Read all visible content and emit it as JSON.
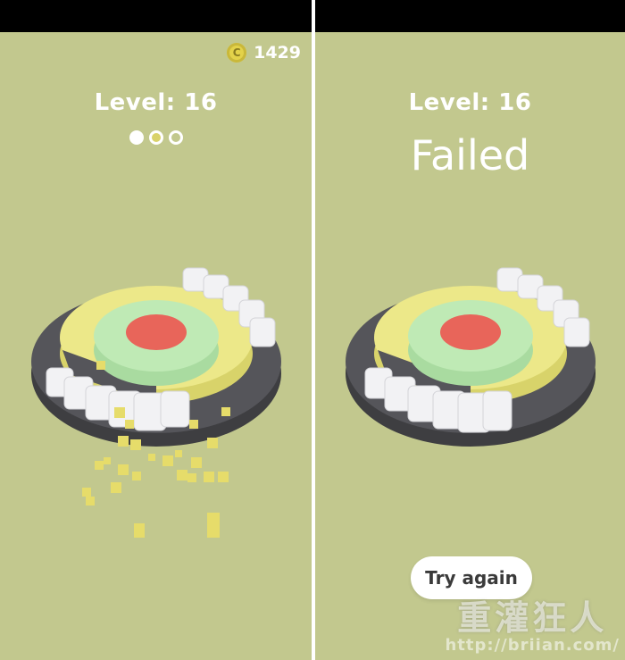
{
  "left_panel": {
    "coins": {
      "icon": "coin-icon",
      "symbol": "C",
      "count": "1429"
    },
    "level_label": "Level: 16",
    "stage_progress": {
      "total": 3,
      "completed": 1,
      "current_index": 2
    }
  },
  "right_panel": {
    "level_label": "Level: 16",
    "status": "Failed",
    "try_again_label": "Try again"
  },
  "watermark": {
    "logo": "重灌狂人",
    "url": "http://briian.com/"
  },
  "colors": {
    "background": "#c2c88e",
    "yellow_ring": "#ede98a",
    "green_ring": "#bde9b2",
    "red_core": "#e8655a",
    "dark_base": "#4b4b4e",
    "white_blocks": "#f0f0f2"
  }
}
